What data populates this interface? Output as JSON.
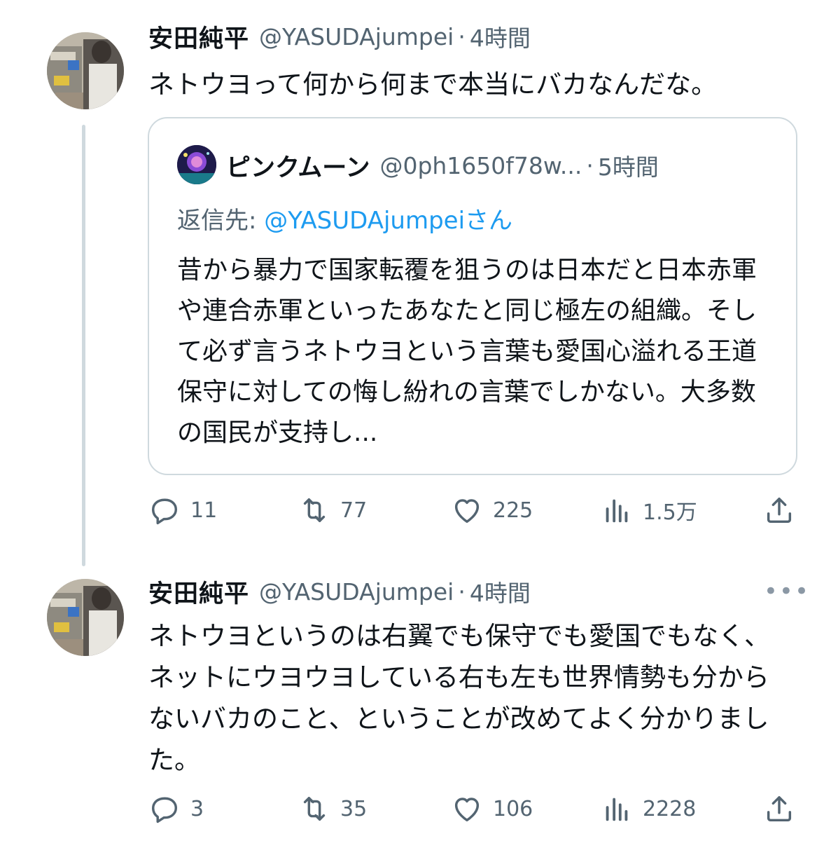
{
  "tweet1": {
    "name": "安田純平",
    "handle": "@YASUDAjumpei",
    "separator": "·",
    "time": "4時間",
    "text": "ネトウヨって何から何まで本当にバカなんだな。",
    "quote": {
      "name": "ピンクムーン",
      "handle": "@0ph1650f78w...",
      "separator": "·",
      "time": "5時間",
      "reply_prefix": "返信先: ",
      "reply_mention": "@YASUDAjumpei",
      "reply_suffix": "さん",
      "text": "昔から暴力で国家転覆を狙うのは日本だと日本赤軍や連合赤軍といったあなたと同じ極左の組織。そして必ず言うネトウヨという言葉も愛国心溢れる王道保守に対しての悔し紛れの言葉でしかない。大多数の国民が支持し..."
    },
    "stats": {
      "replies": "11",
      "retweets": "77",
      "likes": "225",
      "views": "1.5万"
    }
  },
  "tweet2": {
    "name": "安田純平",
    "handle": "@YASUDAjumpei",
    "separator": "·",
    "time": "4時間",
    "more": "•••",
    "text": "ネトウヨというのは右翼でも保守でも愛国でもなく、ネットにウヨウヨしている右も左も世界情勢も分からないバカのこと、ということが改めてよく分かりました。",
    "stats": {
      "replies": "3",
      "retweets": "35",
      "likes": "106",
      "views": "2228"
    }
  },
  "colors": {
    "text": "#0f1419",
    "secondary": "#536471",
    "link": "#1d9bf0",
    "border": "#cfd9de"
  },
  "icons": [
    "reply-icon",
    "retweet-icon",
    "like-icon",
    "views-icon",
    "share-icon",
    "more-icon"
  ]
}
